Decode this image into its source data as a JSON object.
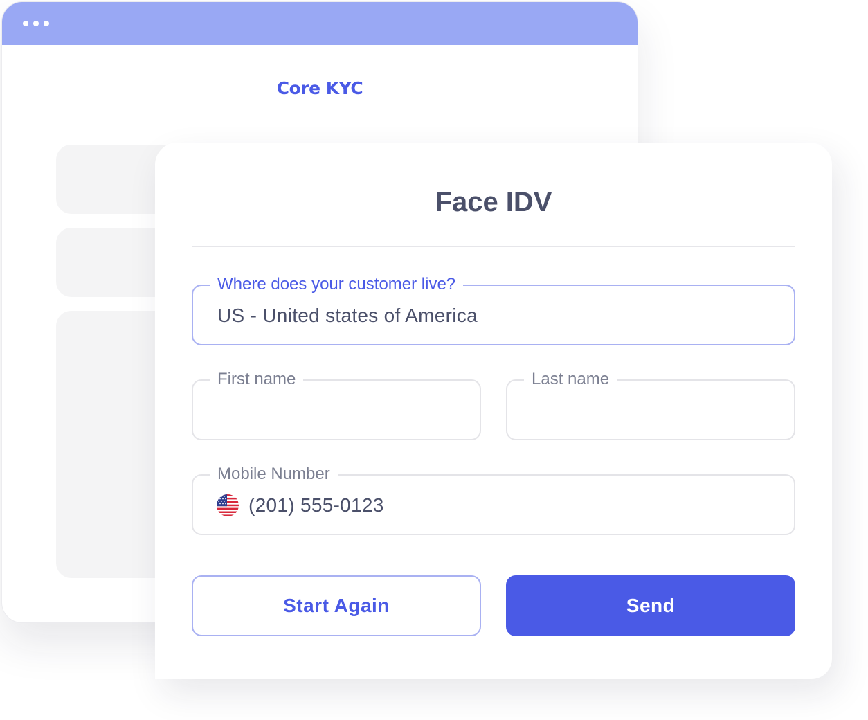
{
  "window": {
    "brand": "Core KYC"
  },
  "form": {
    "title": "Face IDV",
    "country": {
      "label": "Where does your customer live?",
      "value": "US - United states of America"
    },
    "first_name": {
      "label": "First name",
      "value": ""
    },
    "last_name": {
      "label": "Last name",
      "value": ""
    },
    "mobile": {
      "label": "Mobile Number",
      "flag_icon": "us-flag-icon",
      "value": "(201) 555-0123"
    },
    "buttons": {
      "start_again": "Start Again",
      "send": "Send"
    }
  },
  "colors": {
    "accent": "#4a5ae6",
    "titlebar": "#99a8f4",
    "heading": "#4b506a"
  }
}
